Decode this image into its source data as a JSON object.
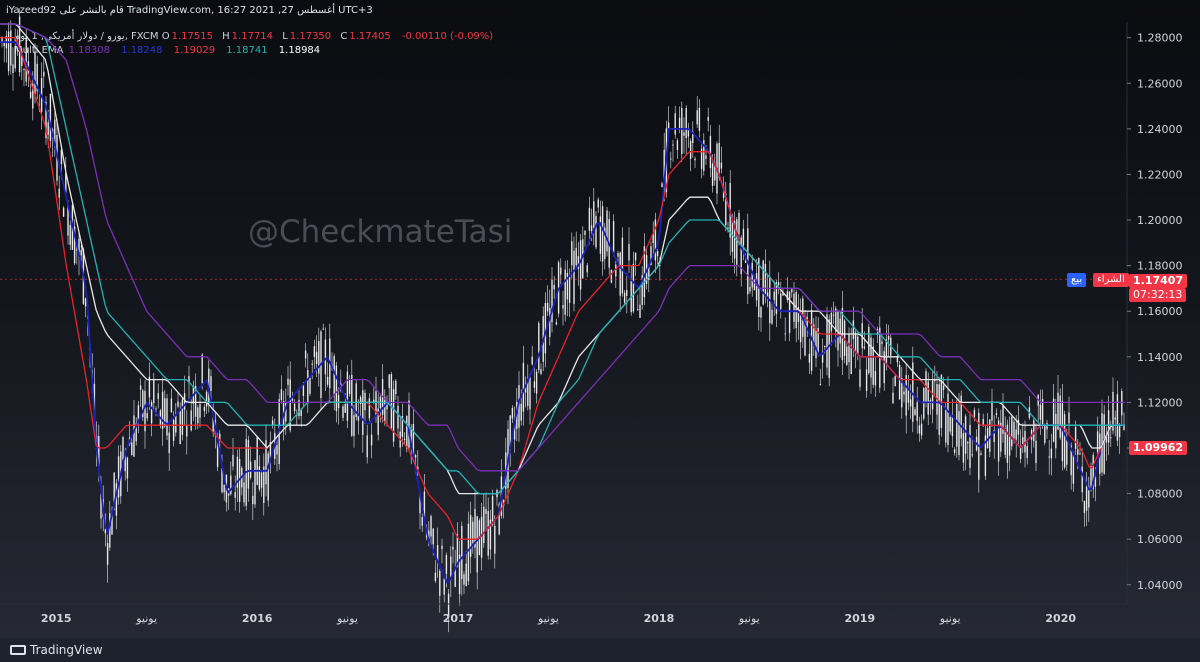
{
  "header": {
    "published_line": "iYazeed92 قام بالنشر على TradingView.com, أغسطس 27, 2021 16:27 UTC+3"
  },
  "legend": {
    "symbol": "يورو / دولار أمريكي, 1 يوم, FXCM",
    "o_label": "O",
    "o": "1.17515",
    "h_label": "H",
    "h": "1.17714",
    "l_label": "L",
    "l": "1.17350",
    "c_label": "C",
    "c": "1.17405",
    "change": "-0.00110 (-0.09%)",
    "indicator": "Multi EMA",
    "ema_values": [
      "1.18308",
      "1.18248",
      "1.19029",
      "1.18741",
      "1.18984"
    ]
  },
  "watermark": "@CheckmateTasi",
  "price_tags": {
    "buy": "الشراء",
    "sell": "بيع",
    "current_price": "1.17407",
    "countdown": "07:32:13",
    "ema_price": "1.09962"
  },
  "branding": {
    "logo_text": "TradingView"
  },
  "colors": {
    "ema_fast": "#1a22b8",
    "ema_red": "#e8222a",
    "ema_white": "#e8e8e8",
    "ema_teal": "#1fb3b3",
    "ema_purple": "#7b2fb8",
    "up_candle": "#e8e8e8",
    "down_candle": "#e8e8e8",
    "tag_red": "#f23645",
    "tag_blue": "#2962ff"
  },
  "chart_data": {
    "type": "line",
    "title": "",
    "xlabel": "",
    "ylabel": "",
    "ylim": [
      1.032,
      1.286
    ],
    "grid": false,
    "y_ticks": [
      "1.28000",
      "1.26000",
      "1.24000",
      "1.22000",
      "1.20000",
      "1.18000",
      "1.16000",
      "1.14000",
      "1.12000",
      "1.10000",
      "1.08000",
      "1.06000",
      "1.04000"
    ],
    "x_ticks": [
      "2015",
      "يونيو",
      "2016",
      "يونيو",
      "2017",
      "يونيو",
      "2018",
      "يونيو",
      "2019",
      "يونيو",
      "2020"
    ],
    "x": [
      2014.8,
      2014.95,
      2015.05,
      2015.15,
      2015.2,
      2015.25,
      2015.35,
      2015.45,
      2015.55,
      2015.65,
      2015.75,
      2015.85,
      2015.95,
      2016.05,
      2016.15,
      2016.25,
      2016.35,
      2016.45,
      2016.55,
      2016.65,
      2016.75,
      2016.85,
      2016.95,
      2017.0,
      2017.1,
      2017.2,
      2017.3,
      2017.4,
      2017.5,
      2017.6,
      2017.7,
      2017.8,
      2017.9,
      2018.0,
      2018.05,
      2018.15,
      2018.25,
      2018.3,
      2018.4,
      2018.5,
      2018.6,
      2018.7,
      2018.8,
      2018.9,
      2019.0,
      2019.1,
      2019.2,
      2019.3,
      2019.4,
      2019.5,
      2019.6,
      2019.7,
      2019.8,
      2019.9,
      2020.0,
      2020.1,
      2020.15,
      2020.2,
      2020.25
    ],
    "series": [
      {
        "name": "",
        "values": [
          1.278,
          1.25,
          1.21,
          1.17,
          1.1,
          1.06,
          1.1,
          1.12,
          1.11,
          1.12,
          1.13,
          1.08,
          1.09,
          1.09,
          1.12,
          1.13,
          1.14,
          1.12,
          1.11,
          1.12,
          1.11,
          1.06,
          1.04,
          1.05,
          1.06,
          1.07,
          1.12,
          1.14,
          1.17,
          1.18,
          1.2,
          1.18,
          1.17,
          1.19,
          1.24,
          1.24,
          1.23,
          1.22,
          1.19,
          1.17,
          1.16,
          1.16,
          1.14,
          1.15,
          1.14,
          1.14,
          1.13,
          1.12,
          1.12,
          1.11,
          1.1,
          1.11,
          1.1,
          1.11,
          1.11,
          1.09,
          1.08,
          1.1,
          1.11
        ]
      },
      {
        "name": "",
        "values": [
          1.28,
          1.24,
          1.18,
          1.13,
          1.1,
          1.1,
          1.11,
          1.11,
          1.11,
          1.11,
          1.11,
          1.1,
          1.1,
          1.1,
          1.11,
          1.12,
          1.12,
          1.12,
          1.12,
          1.11,
          1.1,
          1.08,
          1.07,
          1.06,
          1.06,
          1.07,
          1.09,
          1.12,
          1.14,
          1.16,
          1.17,
          1.18,
          1.18,
          1.2,
          1.22,
          1.23,
          1.23,
          1.22,
          1.19,
          1.18,
          1.17,
          1.16,
          1.15,
          1.15,
          1.14,
          1.14,
          1.13,
          1.13,
          1.12,
          1.12,
          1.11,
          1.11,
          1.1,
          1.11,
          1.11,
          1.1,
          1.09,
          1.1,
          1.11
        ]
      },
      {
        "name": "",
        "values": [
          1.286,
          1.27,
          1.22,
          1.18,
          1.16,
          1.15,
          1.14,
          1.13,
          1.13,
          1.12,
          1.12,
          1.11,
          1.11,
          1.1,
          1.11,
          1.11,
          1.12,
          1.12,
          1.12,
          1.12,
          1.11,
          1.1,
          1.09,
          1.08,
          1.08,
          1.08,
          1.09,
          1.11,
          1.12,
          1.14,
          1.15,
          1.16,
          1.17,
          1.18,
          1.2,
          1.21,
          1.21,
          1.2,
          1.19,
          1.18,
          1.17,
          1.16,
          1.16,
          1.15,
          1.15,
          1.14,
          1.14,
          1.13,
          1.13,
          1.12,
          1.12,
          1.12,
          1.11,
          1.11,
          1.11,
          1.11,
          1.1,
          1.1,
          1.11
        ]
      },
      {
        "name": "",
        "values": [
          1.286,
          1.28,
          1.24,
          1.2,
          1.18,
          1.16,
          1.15,
          1.14,
          1.13,
          1.13,
          1.12,
          1.12,
          1.11,
          1.11,
          1.11,
          1.12,
          1.12,
          1.12,
          1.12,
          1.12,
          1.11,
          1.1,
          1.09,
          1.09,
          1.08,
          1.08,
          1.09,
          1.1,
          1.12,
          1.13,
          1.15,
          1.16,
          1.17,
          1.18,
          1.19,
          1.2,
          1.2,
          1.2,
          1.19,
          1.18,
          1.17,
          1.17,
          1.16,
          1.16,
          1.15,
          1.15,
          1.14,
          1.14,
          1.13,
          1.13,
          1.12,
          1.12,
          1.12,
          1.11,
          1.11,
          1.11,
          1.11,
          1.11,
          1.11
        ]
      },
      {
        "name": "",
        "values": [
          1.286,
          1.28,
          1.27,
          1.24,
          1.22,
          1.2,
          1.18,
          1.16,
          1.15,
          1.14,
          1.14,
          1.13,
          1.13,
          1.12,
          1.12,
          1.12,
          1.12,
          1.13,
          1.13,
          1.12,
          1.12,
          1.11,
          1.11,
          1.1,
          1.09,
          1.09,
          1.09,
          1.1,
          1.11,
          1.12,
          1.13,
          1.14,
          1.15,
          1.16,
          1.17,
          1.18,
          1.18,
          1.18,
          1.18,
          1.17,
          1.17,
          1.17,
          1.16,
          1.16,
          1.16,
          1.15,
          1.15,
          1.15,
          1.14,
          1.14,
          1.13,
          1.13,
          1.13,
          1.12,
          1.12,
          1.12,
          1.12,
          1.12,
          1.12
        ]
      }
    ],
    "last_close_price": 1.17407
  }
}
